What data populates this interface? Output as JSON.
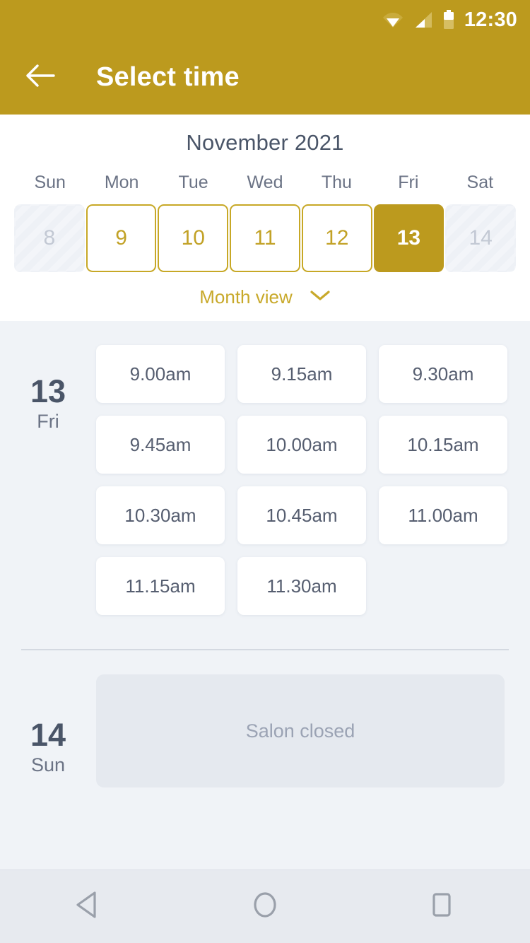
{
  "status_bar": {
    "time": "12:30",
    "icons": [
      "wifi-icon",
      "signal-icon",
      "battery-icon"
    ]
  },
  "app_bar": {
    "back_icon": "back-arrow-icon",
    "title": "Select time"
  },
  "calendar": {
    "month_title": "November 2021",
    "weekdays": [
      "Sun",
      "Mon",
      "Tue",
      "Wed",
      "Thu",
      "Fri",
      "Sat"
    ],
    "days": [
      {
        "number": "8",
        "state": "disabled"
      },
      {
        "number": "9",
        "state": "available"
      },
      {
        "number": "10",
        "state": "available"
      },
      {
        "number": "11",
        "state": "available"
      },
      {
        "number": "12",
        "state": "available"
      },
      {
        "number": "13",
        "state": "selected"
      },
      {
        "number": "14",
        "state": "disabled"
      }
    ],
    "month_view_label": "Month view",
    "month_view_icon": "chevron-down-icon"
  },
  "schedule": [
    {
      "day_number": "13",
      "day_name": "Fri",
      "closed": false,
      "slots": [
        "9.00am",
        "9.15am",
        "9.30am",
        "9.45am",
        "10.00am",
        "10.15am",
        "10.30am",
        "10.45am",
        "11.00am",
        "11.15am",
        "11.30am"
      ]
    },
    {
      "day_number": "14",
      "day_name": "Sun",
      "closed": true,
      "closed_message": "Salon closed",
      "slots": []
    }
  ],
  "nav_bar": {
    "back_label": "back-triangle-icon",
    "home_label": "home-circle-icon",
    "recents_label": "recents-square-icon"
  },
  "colors": {
    "brand_gold": "#BC9A1E",
    "gold_outline": "#C7A826",
    "content_bg": "#F0F3F7",
    "slate_text": "#4A5568",
    "muted_text": "#9BA3B4"
  }
}
